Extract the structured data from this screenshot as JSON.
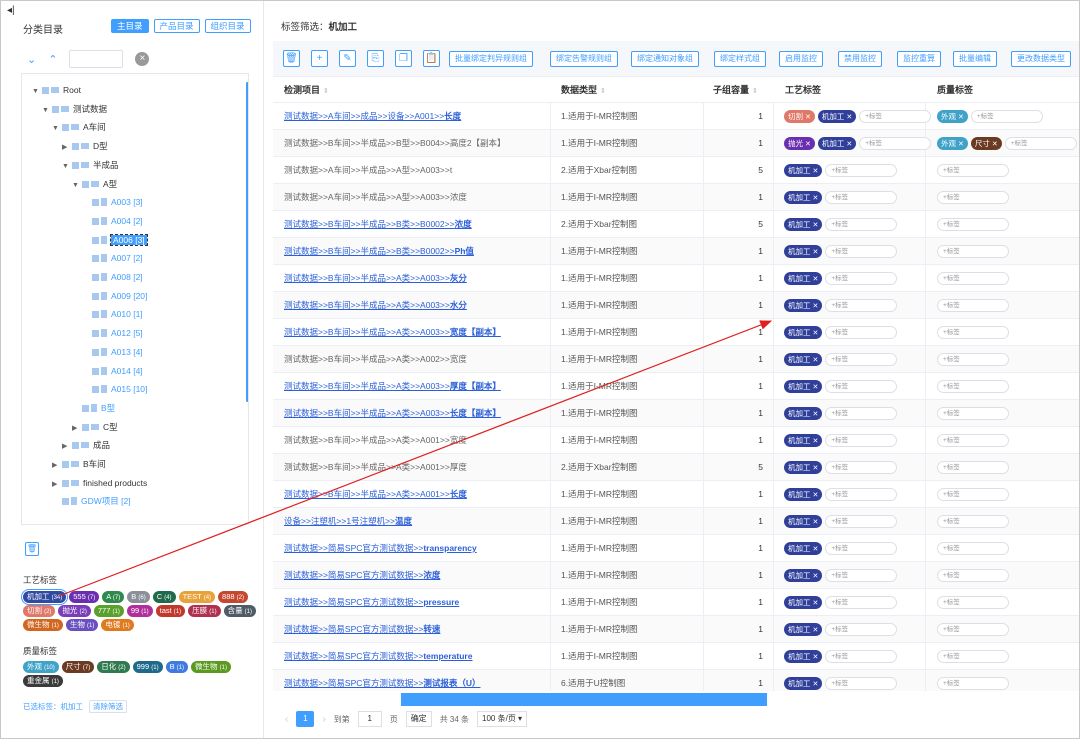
{
  "left": {
    "title": "分类目录",
    "tabs": [
      "主目录",
      "产品目录",
      "组织目录"
    ],
    "tree": [
      {
        "label": "Root",
        "level": 0,
        "arrow": "▼",
        "type": "folder"
      },
      {
        "label": "测试数据",
        "level": 1,
        "arrow": "▼",
        "type": "folder"
      },
      {
        "label": "A车间",
        "level": 2,
        "arrow": "▼",
        "type": "folder"
      },
      {
        "label": "D型",
        "level": 3,
        "arrow": "▶",
        "type": "folder"
      },
      {
        "label": "半成品",
        "level": 3,
        "arrow": "▼",
        "type": "folder"
      },
      {
        "label": "A型",
        "level": 4,
        "arrow": "▼",
        "type": "folder"
      },
      {
        "label": "A003 [3]",
        "level": 5,
        "arrow": "",
        "type": "leaf"
      },
      {
        "label": "A004 [2]",
        "level": 5,
        "arrow": "",
        "type": "leaf"
      },
      {
        "label": "A006 [3]",
        "level": 5,
        "arrow": "",
        "type": "leaf",
        "selected": true
      },
      {
        "label": "A007 [2]",
        "level": 5,
        "arrow": "",
        "type": "leaf"
      },
      {
        "label": "A008 [2]",
        "level": 5,
        "arrow": "",
        "type": "leaf"
      },
      {
        "label": "A009 [20]",
        "level": 5,
        "arrow": "",
        "type": "leaf"
      },
      {
        "label": "A010 [1]",
        "level": 5,
        "arrow": "",
        "type": "leaf"
      },
      {
        "label": "A012 [5]",
        "level": 5,
        "arrow": "",
        "type": "leaf"
      },
      {
        "label": "A013 [4]",
        "level": 5,
        "arrow": "",
        "type": "leaf"
      },
      {
        "label": "A014 [4]",
        "level": 5,
        "arrow": "",
        "type": "leaf"
      },
      {
        "label": "A015 [10]",
        "level": 5,
        "arrow": "",
        "type": "leaf"
      },
      {
        "label": "B型",
        "level": 4,
        "arrow": "",
        "type": "leaf"
      },
      {
        "label": "C型",
        "level": 4,
        "arrow": "▶",
        "type": "folder"
      },
      {
        "label": "成品",
        "level": 3,
        "arrow": "▶",
        "type": "folder"
      },
      {
        "label": "B车间",
        "level": 2,
        "arrow": "▶",
        "type": "folder"
      },
      {
        "label": "finished products",
        "level": 2,
        "arrow": "▶",
        "type": "folder"
      },
      {
        "label": "GDW项目 [2]",
        "level": 2,
        "arrow": "",
        "type": "leaf"
      }
    ],
    "process_tags_title": "工艺标签",
    "process_tags": [
      {
        "label": "机加工",
        "count": "(34)",
        "color": "#2f4aa0",
        "selected": true
      },
      {
        "label": "555",
        "count": "(7)",
        "color": "#6a2fb0"
      },
      {
        "label": "A",
        "count": "(7)",
        "color": "#2f8a4f"
      },
      {
        "label": "B",
        "count": "(6)",
        "color": "#8a8f98"
      },
      {
        "label": "C",
        "count": "(4)",
        "color": "#1f6a4a"
      },
      {
        "label": "TEST",
        "count": "(4)",
        "color": "#e8a23a"
      },
      {
        "label": "888",
        "count": "(2)",
        "color": "#c6472f"
      },
      {
        "label": "切割",
        "count": "(2)",
        "color": "#e0786a"
      },
      {
        "label": "抛光",
        "count": "(2)",
        "color": "#7a3fb8"
      },
      {
        "label": "777",
        "count": "(1)",
        "color": "#5aa02c"
      },
      {
        "label": "99",
        "count": "(1)",
        "color": "#b02f9a"
      },
      {
        "label": "tast",
        "count": "(1)",
        "color": "#c0392b"
      },
      {
        "label": "压膜",
        "count": "(1)",
        "color": "#b0304f"
      },
      {
        "label": "含量",
        "count": "(1)",
        "color": "#4f5b66"
      },
      {
        "label": "微生物",
        "count": "(1)",
        "color": "#d0661f"
      },
      {
        "label": "生物",
        "count": "(1)",
        "color": "#6a4fc0"
      },
      {
        "label": "电镀",
        "count": "(1)",
        "color": "#e07a1f"
      }
    ],
    "quality_tags_title": "质量标签",
    "quality_tags": [
      {
        "label": "外观",
        "count": "(10)",
        "color": "#3fa2c8"
      },
      {
        "label": "尺寸",
        "count": "(7)",
        "color": "#6b3a22"
      },
      {
        "label": "日化",
        "count": "(2)",
        "color": "#2f7a4f"
      },
      {
        "label": "999",
        "count": "(1)",
        "color": "#1f6a8a"
      },
      {
        "label": "B",
        "count": "(1)",
        "color": "#3f7ae0"
      },
      {
        "label": "微生物",
        "count": "(1)",
        "color": "#5a9a1f"
      },
      {
        "label": "重金属",
        "count": "(1)",
        "color": "#3a3a3a"
      }
    ],
    "selected_label": "已选标签：机加工",
    "clear_filter": "清除筛选"
  },
  "main": {
    "filter_title": "标签筛选：",
    "filter_value": "机加工",
    "toolbar_icons": [
      "trash-icon",
      "plus-icon",
      "edit-icon",
      "copy-icon",
      "duplicate-icon",
      "paste-icon"
    ],
    "toolbar_buttons": [
      "批量绑定判异规则组",
      "绑定告警规则组",
      "绑定通知对象组",
      "绑定样式组",
      "启用监控",
      "禁用监控",
      "监控重算",
      "批量编辑",
      "更改数据类型"
    ],
    "columns": [
      "检测项目",
      "数据类型",
      "子组容量",
      "工艺标签",
      "质量标签"
    ],
    "add_tag": "+标签",
    "rows": [
      {
        "item_prefix": "测试数据>>A车间>>成品>>设备>>A001>>",
        "item_suffix": "长度",
        "link": true,
        "dtype": "1.适用于I-MR控制图",
        "n": "1",
        "ptags": [
          "切割",
          "机加工"
        ],
        "qtags": [
          "外观"
        ]
      },
      {
        "item_prefix": "测试数据>>B车间>>半成品>>B型>>B004>>高度2【副本】",
        "item_suffix": "",
        "link": false,
        "dtype": "1.适用于I-MR控制图",
        "n": "1",
        "ptags": [
          "抛光",
          "机加工"
        ],
        "qtags": [
          "外观",
          "尺寸"
        ]
      },
      {
        "item_prefix": "测试数据>>A车间>>半成品>>A型>>A003>>t",
        "item_suffix": "",
        "link": false,
        "dtype": "2.适用于Xbar控制图",
        "n": "5",
        "ptags": [
          "机加工"
        ],
        "qtags": []
      },
      {
        "item_prefix": "测试数据>>A车间>>半成品>>A型>>A003>>浓度",
        "item_suffix": "",
        "link": false,
        "dtype": "1.适用于I-MR控制图",
        "n": "1",
        "ptags": [
          "机加工"
        ],
        "qtags": []
      },
      {
        "item_prefix": "测试数据>>B车间>>半成品>>B类>>B0002>>",
        "item_suffix": "浓度",
        "link": true,
        "dtype": "2.适用于Xbar控制图",
        "n": "5",
        "ptags": [
          "机加工"
        ],
        "qtags": []
      },
      {
        "item_prefix": "测试数据>>B车间>>半成品>>B类>>B0002>>",
        "item_suffix": "Ph值",
        "link": true,
        "dtype": "1.适用于I-MR控制图",
        "n": "1",
        "ptags": [
          "机加工"
        ],
        "qtags": []
      },
      {
        "item_prefix": "测试数据>>B车间>>半成品>>A类>>A003>>",
        "item_suffix": "灰分",
        "link": true,
        "dtype": "1.适用于I-MR控制图",
        "n": "1",
        "ptags": [
          "机加工"
        ],
        "qtags": []
      },
      {
        "item_prefix": "测试数据>>B车间>>半成品>>A类>>A003>>",
        "item_suffix": "水分",
        "link": true,
        "dtype": "1.适用于I-MR控制图",
        "n": "1",
        "ptags": [
          "机加工"
        ],
        "qtags": []
      },
      {
        "item_prefix": "测试数据>>B车间>>半成品>>A类>>A003>>",
        "item_suffix": "宽度【副本】",
        "link": true,
        "dtype": "1.适用于I-MR控制图",
        "n": "1",
        "ptags": [
          "机加工"
        ],
        "qtags": []
      },
      {
        "item_prefix": "测试数据>>B车间>>半成品>>A类>>A002>>宽度",
        "item_suffix": "",
        "link": false,
        "dtype": "1.适用于I-MR控制图",
        "n": "1",
        "ptags": [
          "机加工"
        ],
        "qtags": []
      },
      {
        "item_prefix": "测试数据>>B车间>>半成品>>A类>>A003>>",
        "item_suffix": "厚度【副本】",
        "link": true,
        "dtype": "1.适用于I-MR控制图",
        "n": "1",
        "ptags": [
          "机加工"
        ],
        "qtags": []
      },
      {
        "item_prefix": "测试数据>>B车间>>半成品>>A类>>A003>>",
        "item_suffix": "长度【副本】",
        "link": true,
        "dtype": "1.适用于I-MR控制图",
        "n": "1",
        "ptags": [
          "机加工"
        ],
        "qtags": []
      },
      {
        "item_prefix": "测试数据>>B车间>>半成品>>A类>>A001>>宽度",
        "item_suffix": "",
        "link": false,
        "dtype": "1.适用于I-MR控制图",
        "n": "1",
        "ptags": [
          "机加工"
        ],
        "qtags": []
      },
      {
        "item_prefix": "测试数据>>B车间>>半成品>>A类>>A001>>厚度",
        "item_suffix": "",
        "link": false,
        "dtype": "2.适用于Xbar控制图",
        "n": "5",
        "ptags": [
          "机加工"
        ],
        "qtags": []
      },
      {
        "item_prefix": "测试数据>>B车间>>半成品>>A类>>A001>>",
        "item_suffix": "长度",
        "link": true,
        "dtype": "1.适用于I-MR控制图",
        "n": "1",
        "ptags": [
          "机加工"
        ],
        "qtags": []
      },
      {
        "item_prefix": "设备>>注塑机>>1号注塑机>>",
        "item_suffix": "温度",
        "link": true,
        "dtype": "1.适用于I-MR控制图",
        "n": "1",
        "ptags": [
          "机加工"
        ],
        "qtags": []
      },
      {
        "item_prefix": "测试数据>>简易SPC官方测试数据>>",
        "item_suffix": "transparency",
        "link": true,
        "dtype": "1.适用于I-MR控制图",
        "n": "1",
        "ptags": [
          "机加工"
        ],
        "qtags": []
      },
      {
        "item_prefix": "测试数据>>简易SPC官方测试数据>>",
        "item_suffix": "浓度",
        "link": true,
        "dtype": "1.适用于I-MR控制图",
        "n": "1",
        "ptags": [
          "机加工"
        ],
        "qtags": []
      },
      {
        "item_prefix": "测试数据>>简易SPC官方测试数据>>",
        "item_suffix": "pressure",
        "link": true,
        "dtype": "1.适用于I-MR控制图",
        "n": "1",
        "ptags": [
          "机加工"
        ],
        "qtags": []
      },
      {
        "item_prefix": "测试数据>>简易SPC官方测试数据>>",
        "item_suffix": "转速",
        "link": true,
        "dtype": "1.适用于I-MR控制图",
        "n": "1",
        "ptags": [
          "机加工"
        ],
        "qtags": []
      },
      {
        "item_prefix": "测试数据>>简易SPC官方测试数据>>",
        "item_suffix": "temperature",
        "link": true,
        "dtype": "1.适用于I-MR控制图",
        "n": "1",
        "ptags": [
          "机加工"
        ],
        "qtags": []
      },
      {
        "item_prefix": "测试数据>>简易SPC官方测试数据>>",
        "item_suffix": "测试报表（U）",
        "link": true,
        "dtype": "6.适用于U控制图",
        "n": "1",
        "ptags": [
          "机加工"
        ],
        "qtags": []
      }
    ],
    "tag_colors": {
      "切割": "#e0786a",
      "机加工": "#2f3f9a",
      "抛光": "#6a2fb0",
      "外观": "#3fa2c8",
      "尺寸": "#6b3a22"
    },
    "pager": {
      "current": "1",
      "goto_label": "到第",
      "goto_value": "1",
      "page_unit": "页",
      "confirm": "确定",
      "total": "共 34 条",
      "page_size": "100 条/页"
    }
  }
}
